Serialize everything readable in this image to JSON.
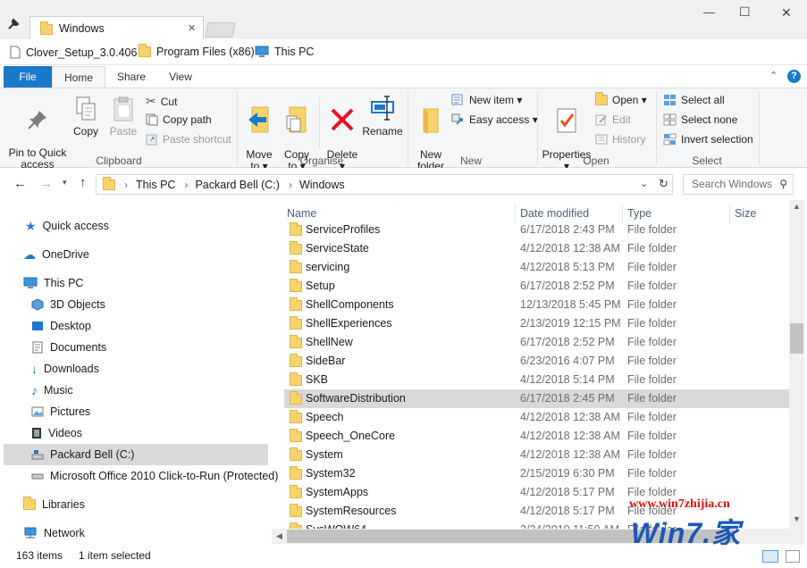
{
  "window": {
    "tab_title": "Windows",
    "minimize": "—",
    "maximize": "☐",
    "close": "✕"
  },
  "quick_access_bar": {
    "items": [
      "Clover_Setup_3.0.406",
      "Program Files (x86)",
      "This PC"
    ]
  },
  "ribbon_tabs": {
    "file": "File",
    "home": "Home",
    "share": "Share",
    "view": "View"
  },
  "ribbon": {
    "clipboard": {
      "pin": "Pin to Quick\naccess",
      "copy": "Copy",
      "paste": "Paste",
      "cut": "Cut",
      "copy_path": "Copy path",
      "paste_shortcut": "Paste shortcut",
      "label": "Clipboard"
    },
    "organise": {
      "move_to": "Move\nto ▾",
      "copy_to": "Copy\nto ▾",
      "delete": "Delete\n▾",
      "rename": "Rename",
      "label": "Organise"
    },
    "new": {
      "new_folder": "New\nfolder",
      "new_item": "New item ▾",
      "easy_access": "Easy access ▾",
      "label": "New"
    },
    "open": {
      "properties": "Properties\n▾",
      "open": "Open ▾",
      "edit": "Edit",
      "history": "History",
      "label": "Open"
    },
    "select": {
      "select_all": "Select all",
      "select_none": "Select none",
      "invert_selection": "Invert selection",
      "label": "Select"
    }
  },
  "address": {
    "breadcrumb": [
      "This PC",
      "Packard Bell (C:)",
      "Windows"
    ],
    "search_placeholder": "Search Windows"
  },
  "nav": {
    "quick_access": "Quick access",
    "onedrive": "OneDrive",
    "this_pc": "This PC",
    "objects3d": "3D Objects",
    "desktop": "Desktop",
    "documents": "Documents",
    "downloads": "Downloads",
    "music": "Music",
    "pictures": "Pictures",
    "videos": "Videos",
    "drive_c": "Packard Bell (C:)",
    "office": "Microsoft Office 2010 Click-to-Run (Protected)",
    "libraries": "Libraries",
    "network": "Network"
  },
  "columns": {
    "name": "Name",
    "date": "Date modified",
    "type": "Type",
    "size": "Size"
  },
  "files": [
    {
      "name": "ServiceProfiles",
      "date": "6/17/2018 2:43 PM",
      "type": "File folder"
    },
    {
      "name": "ServiceState",
      "date": "4/12/2018 12:38 AM",
      "type": "File folder"
    },
    {
      "name": "servicing",
      "date": "4/12/2018 5:13 PM",
      "type": "File folder"
    },
    {
      "name": "Setup",
      "date": "6/17/2018 2:52 PM",
      "type": "File folder"
    },
    {
      "name": "ShellComponents",
      "date": "12/13/2018 5:45 PM",
      "type": "File folder"
    },
    {
      "name": "ShellExperiences",
      "date": "2/13/2019 12:15 PM",
      "type": "File folder"
    },
    {
      "name": "ShellNew",
      "date": "6/17/2018 2:52 PM",
      "type": "File folder"
    },
    {
      "name": "SideBar",
      "date": "6/23/2016 4:07 PM",
      "type": "File folder"
    },
    {
      "name": "SKB",
      "date": "4/12/2018 5:14 PM",
      "type": "File folder"
    },
    {
      "name": "SoftwareDistribution",
      "date": "6/17/2018 2:45 PM",
      "type": "File folder"
    },
    {
      "name": "Speech",
      "date": "4/12/2018 12:38 AM",
      "type": "File folder"
    },
    {
      "name": "Speech_OneCore",
      "date": "4/12/2018 12:38 AM",
      "type": "File folder"
    },
    {
      "name": "System",
      "date": "4/12/2018 12:38 AM",
      "type": "File folder"
    },
    {
      "name": "System32",
      "date": "2/15/2019 6:30 PM",
      "type": "File folder"
    },
    {
      "name": "SystemApps",
      "date": "4/12/2018 5:17 PM",
      "type": "File folder"
    },
    {
      "name": "SystemResources",
      "date": "4/12/2018 5:17 PM",
      "type": "File folder"
    },
    {
      "name": "SysWOW64",
      "date": "2/24/2019 11:50 AM",
      "type": "File folder"
    }
  ],
  "selected_row": "SoftwareDistribution",
  "status": {
    "count": "163 items",
    "selected": "1 item selected"
  },
  "watermark": {
    "url": "www.win7zhijia.cn",
    "logo": "Win7.家"
  },
  "colors": {
    "accent": "#1979ca",
    "selection": "#d9d9d9",
    "header_text": "#4c607a",
    "delete_red": "#e81123",
    "watermark_red": "#d7140c"
  }
}
